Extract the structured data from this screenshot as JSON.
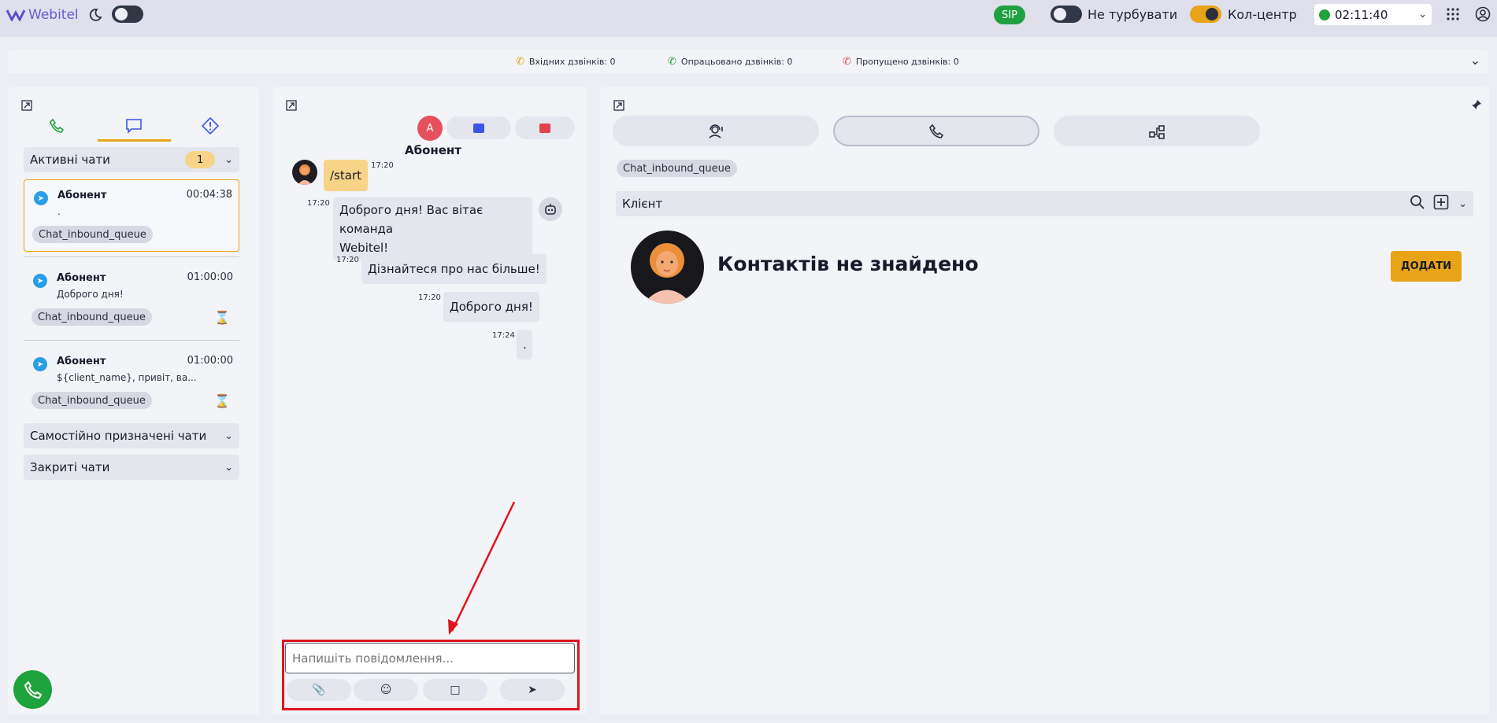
{
  "topbar": {
    "logo": "Webitel",
    "sip": "SIP",
    "dnd_label": "Не турбувати",
    "callcenter_label": "Кол-центр",
    "timer": "02:11:40"
  },
  "stats": {
    "incoming": "Вхідних дзвінків: 0",
    "processed": "Опрацьовано дзвінків: 0",
    "missed": "Пропущено дзвінків: 0"
  },
  "left": {
    "active_chats_label": "Активні чати",
    "active_chats_count": "1",
    "chats": [
      {
        "name": "Абонент",
        "time": "00:04:38",
        "message": ".",
        "queue": "Chat_inbound_queue"
      },
      {
        "name": "Абонент",
        "time": "01:00:00",
        "message": "Доброго дня!",
        "queue": "Chat_inbound_queue"
      },
      {
        "name": "Абонент",
        "time": "01:00:00",
        "message": "${client_name}, привіт, ва...",
        "queue": "Chat_inbound_queue"
      }
    ],
    "self_assigned_label": "Самостійно призначені чати",
    "closed_label": "Закриті чати"
  },
  "chat": {
    "avatar_letter": "А",
    "participant": "Абонент",
    "messages": [
      {
        "text": "/start",
        "time": "17:20"
      },
      {
        "text_line1": "Доброго дня! Вас вітає команда",
        "text_line2": "Webitel!",
        "time": "17:20"
      },
      {
        "text": "Дізнайтеся про нас більше!",
        "time": "17:20"
      },
      {
        "text": "Доброго дня!",
        "time": "17:20"
      },
      {
        "text": ".",
        "time": "17:24"
      }
    ],
    "input_placeholder": "Напишіть повідомлення..."
  },
  "right": {
    "queue_chip": "Chat_inbound_queue",
    "client_label": "Клієнт",
    "no_contacts": "Контактів не знайдено",
    "add_button": "ДОДАТИ"
  },
  "colors": {
    "accent": "#e8a317",
    "sip_green": "#20a041",
    "annotation_red": "#e0141d",
    "tab_blue": "#3b55e6"
  }
}
